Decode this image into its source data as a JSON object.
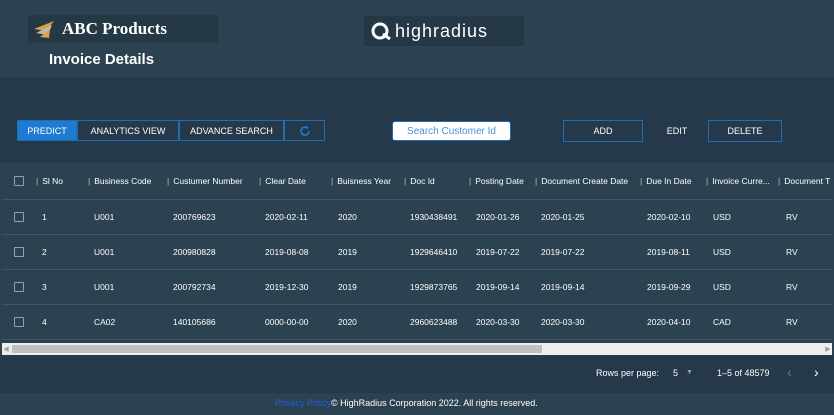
{
  "header": {
    "brand_name": "ABC Products",
    "page_title": "Invoice Details",
    "partner_logo_text": "highradius"
  },
  "toolbar": {
    "predict_label": "PREDICT",
    "analytics_label": "ANALYTICS VIEW",
    "advance_search_label": "ADVANCE SEARCH",
    "search_placeholder": "Search Customer Id",
    "add_label": "ADD",
    "edit_label": "EDIT",
    "delete_label": "DELETE"
  },
  "table": {
    "columns": [
      "Sl No",
      "Business Code",
      "Custumer Number",
      "Clear Date",
      "Buisness Year",
      "Doc Id",
      "Posting Date",
      "Document Create Date",
      "Due In Date",
      "Invoice Curre...",
      "Document T"
    ],
    "rows": [
      [
        "1",
        "U001",
        "200769623",
        "2020-02-11",
        "2020",
        "1930438491",
        "2020-01-26",
        "2020-01-25",
        "2020-02-10",
        "USD",
        "RV"
      ],
      [
        "2",
        "U001",
        "200980828",
        "2019-08-08",
        "2019",
        "1929646410",
        "2019-07-22",
        "2019-07-22",
        "2019-08-11",
        "USD",
        "RV"
      ],
      [
        "3",
        "U001",
        "200792734",
        "2019-12-30",
        "2019",
        "1929873765",
        "2019-09-14",
        "2019-09-14",
        "2019-09-29",
        "USD",
        "RV"
      ],
      [
        "4",
        "CA02",
        "140105686",
        "0000-00-00",
        "2020",
        "2960623488",
        "2020-03-30",
        "2020-03-30",
        "2020-04-10",
        "CAD",
        "RV"
      ]
    ]
  },
  "pagination": {
    "rows_per_page_label": "Rows per page:",
    "rows_per_page_value": "5",
    "range_text": "1–5 of 48579"
  },
  "footer": {
    "link_text": "Privacy Policy",
    "copyright": "© HighRadius Corporation 2022. All rights reserved."
  },
  "colors": {
    "background": "#2c4250",
    "toolbar": "#26394a",
    "accent": "#1f7bd1",
    "link": "#1f5fe0"
  },
  "icons": [
    "company-logo-icon",
    "highradius-logo-icon",
    "refresh-icon",
    "checkbox-icon",
    "chevron-left-icon",
    "chevron-right-icon",
    "caret-down-icon"
  ]
}
